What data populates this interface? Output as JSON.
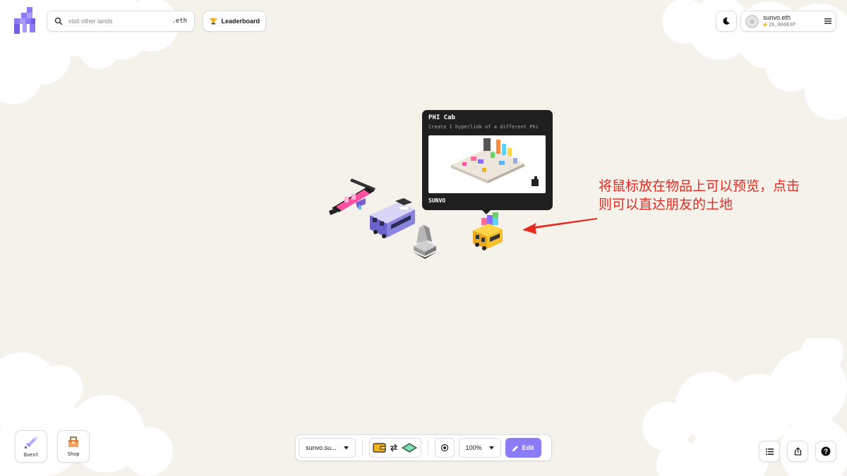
{
  "search": {
    "placeholder": "visit other lands",
    "suffix": ".eth"
  },
  "header": {
    "leaderboard_label": "Leaderboard"
  },
  "profile": {
    "name": "sunvo.eth",
    "exp": "26,000EXP"
  },
  "tooltip": {
    "title": "PHI Cab",
    "description": "Create 1 hyperlink of a different Phi",
    "owner": "SUNVO"
  },
  "annotation": {
    "line1": "将鼠标放在物品上可以预览，点击",
    "line2": "则可以直达朋友的土地"
  },
  "sidebar": {
    "quest_label": "Quest",
    "shop_label": "Shop"
  },
  "toolbar": {
    "land_select": "sunvo.su...",
    "zoom": "100%",
    "edit_label": "Edit"
  },
  "colors": {
    "accent": "#8a7cf7",
    "annotation": "#e52a22",
    "background": "#f5f2ec",
    "tooltip_bg": "#1f1f1f"
  },
  "icons": {
    "logo": "phi-logo-icon",
    "search": "search-icon",
    "leaderboard": "trophy-icon",
    "theme": "moon-icon",
    "menu": "hamburger-menu-icon",
    "quest": "sword-icon",
    "shop": "bag-icon",
    "wallet": "wallet-icon",
    "swap": "swap-arrows-icon",
    "land": "land-tile-icon",
    "center": "target-icon",
    "edit": "pencil-icon",
    "list": "list-icon",
    "share": "share-icon",
    "help": "question-icon"
  }
}
